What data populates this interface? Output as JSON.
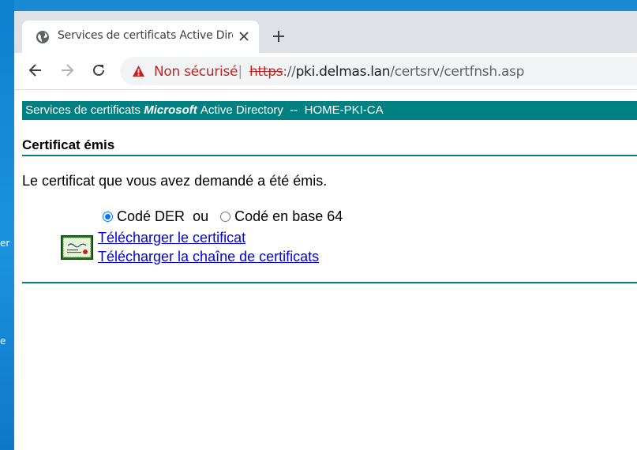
{
  "desktop": {
    "label_1": "er",
    "label_2": "e"
  },
  "browser": {
    "tab": {
      "title": "Services de certificats Active Directory",
      "favicon": "globe-icon",
      "close": "close-icon"
    },
    "new_tab": "plus-icon",
    "nav": {
      "back": "arrow-left-icon",
      "forward": "arrow-right-icon",
      "reload": "reload-icon"
    },
    "address_bar": {
      "security_icon": "warning-triangle-icon",
      "security_label": "Non sécurisé",
      "separator": "|",
      "url_scheme": "https",
      "url_sep": "://",
      "url_host": "pki.delmas.lan",
      "url_path": "/certsrv/certfnsh.asp"
    }
  },
  "page": {
    "banner": {
      "prefix": "Services de certificats",
      "brand": "Microsoft",
      "suffix": "Active Directory",
      "separator": "--",
      "ca_name": "HOME-PKI-CA"
    },
    "heading": "Certificat émis",
    "message": "Le certificat que vous avez demandé a été émis.",
    "encoding": {
      "options": [
        {
          "label": "Codé DER",
          "selected": true
        },
        {
          "label": "Codé en base 64",
          "selected": false
        }
      ],
      "or_text": "ou"
    },
    "cert_icon": "certificate-icon",
    "links": {
      "download_cert": "Télécharger le certificat",
      "download_chain": "Télécharger la chaîne de certificats"
    }
  },
  "colors": {
    "banner": "#008080",
    "link": "#0000ee",
    "not_secure": "#c5221f",
    "desktop": "#1a8ad4"
  }
}
